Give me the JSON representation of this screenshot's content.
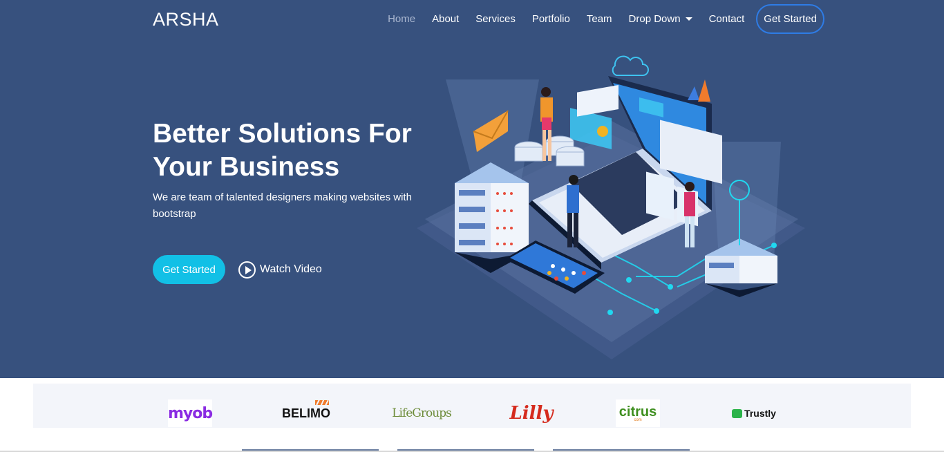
{
  "brand": {
    "name": "ARSHA"
  },
  "nav": {
    "items": [
      {
        "label": "Home",
        "active": true
      },
      {
        "label": "About"
      },
      {
        "label": "Services"
      },
      {
        "label": "Portfolio"
      },
      {
        "label": "Team"
      },
      {
        "label": "Drop Down",
        "dropdown": true
      },
      {
        "label": "Contact"
      }
    ],
    "cta": "Get Started"
  },
  "hero": {
    "title": "Better Solutions For Your Business",
    "subtitle": "We are team of talented designers making websites with bootstrap",
    "primary_button": "Get Started",
    "video_button": "Watch Video"
  },
  "clients": {
    "logos": [
      {
        "name": "myob",
        "icon": "myob-logo"
      },
      {
        "name": "BELIMO",
        "icon": "belimo-logo"
      },
      {
        "name": "LifeGroups",
        "icon": "lifegroups-logo"
      },
      {
        "name": "Lilly",
        "icon": "lilly-logo"
      },
      {
        "name": "citrus",
        "sub": "com",
        "icon": "citrus-logo"
      },
      {
        "name": "Trustly",
        "icon": "trustly-logo"
      }
    ]
  },
  "colors": {
    "hero_bg": "#37517e",
    "accent": "#12c0e6",
    "nav_cta_border": "#2e7ce6",
    "clients_bg": "#f3f5fa"
  }
}
